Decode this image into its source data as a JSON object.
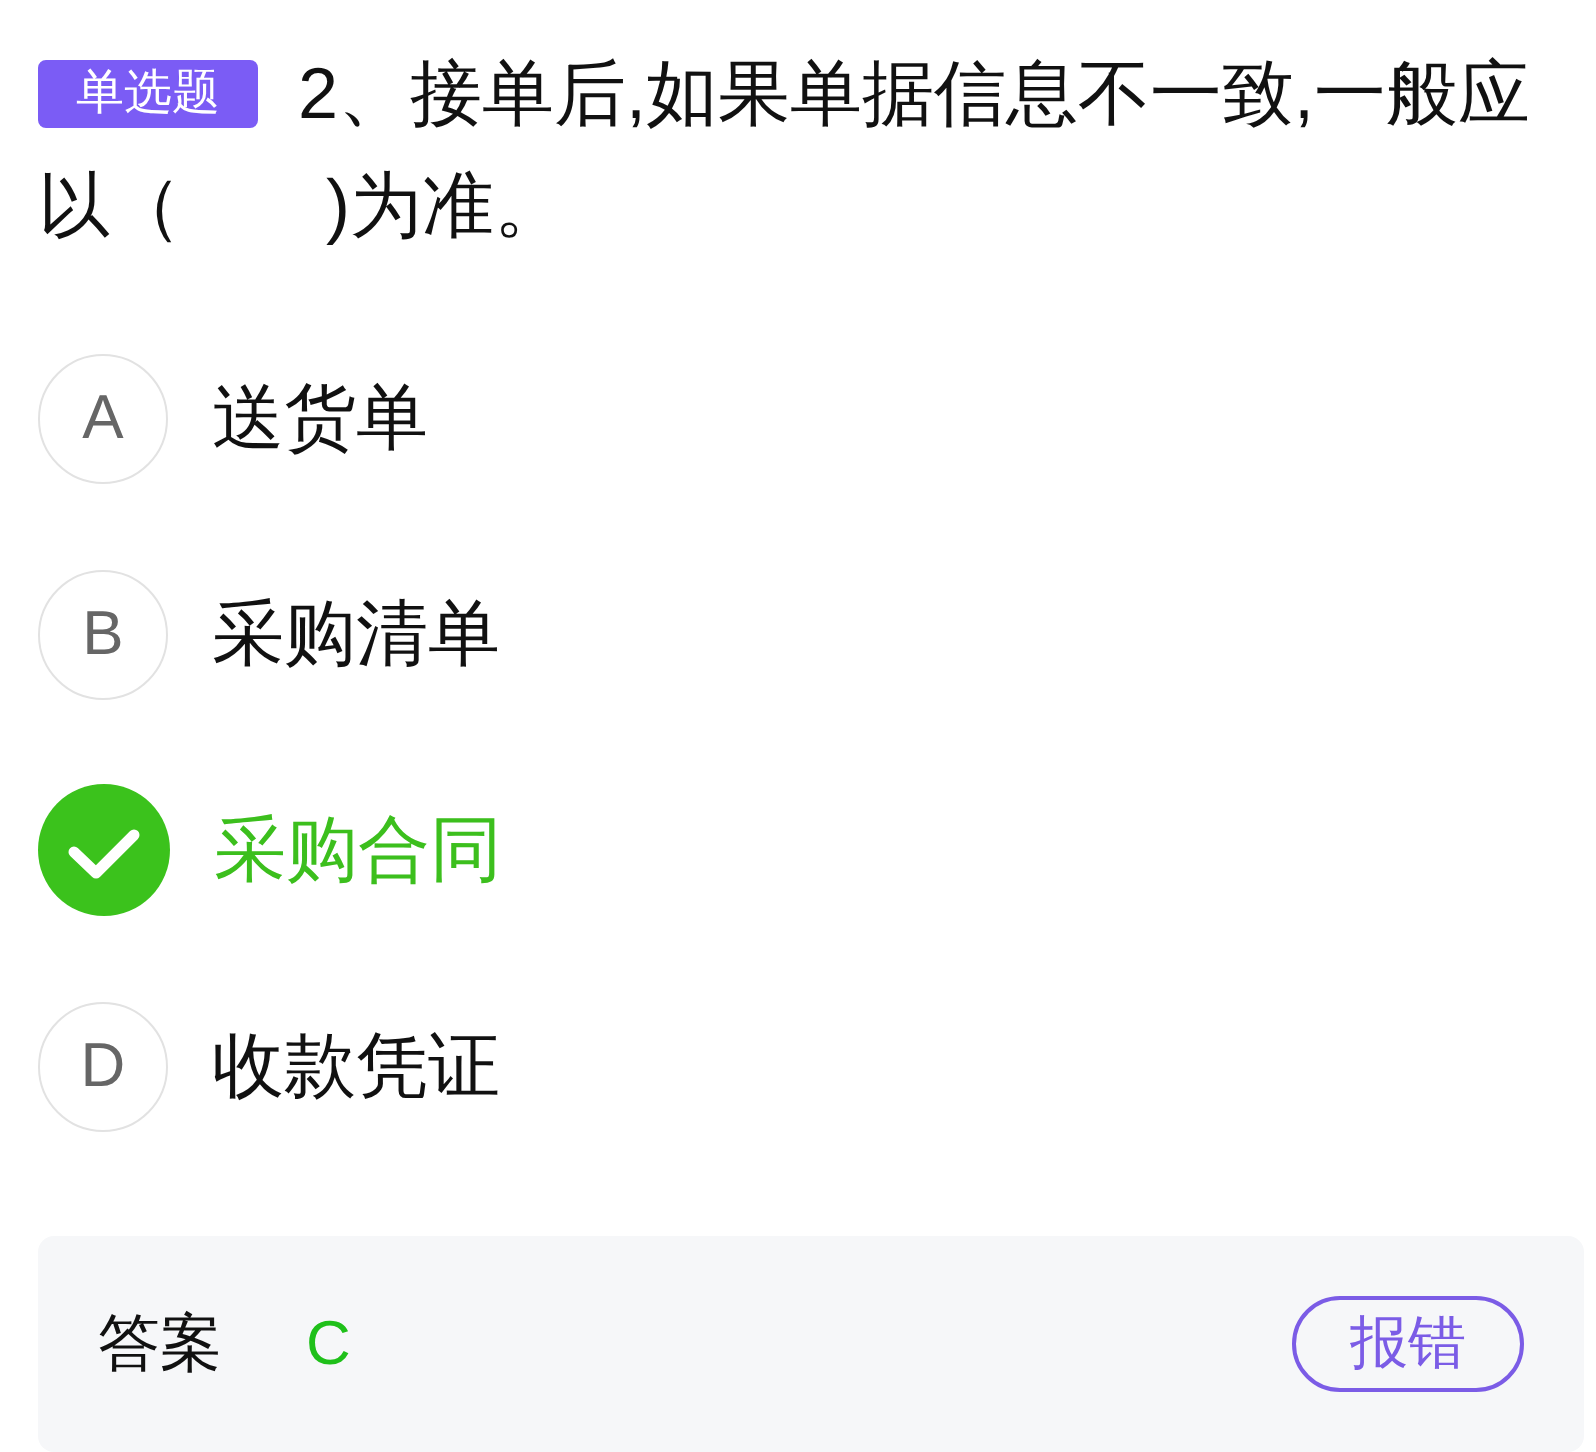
{
  "question": {
    "type_label": "单选题",
    "text": "2、接单后,如果单据信息不一致,一般应以（　　)为准。"
  },
  "options": [
    {
      "letter": "A",
      "text": "送货单",
      "selected": false
    },
    {
      "letter": "B",
      "text": "采购清单",
      "selected": false
    },
    {
      "text": "采购合同",
      "selected": true
    },
    {
      "letter": "D",
      "text": "收款凭证",
      "selected": false
    }
  ],
  "answer": {
    "label": "答案",
    "value": "C"
  },
  "report_button": {
    "label": "报错"
  }
}
